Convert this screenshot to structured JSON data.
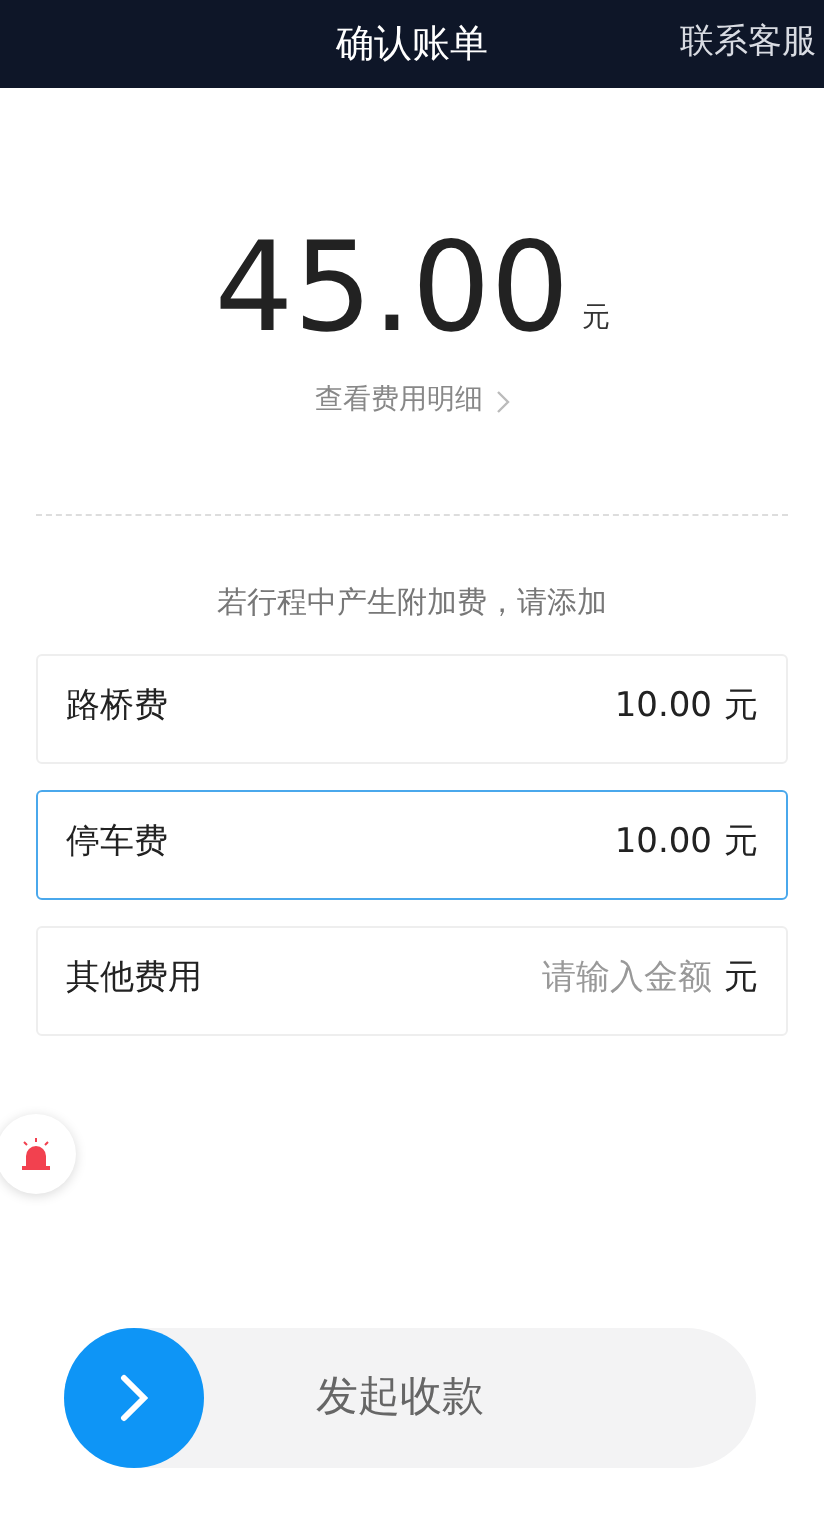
{
  "header": {
    "title": "确认账单",
    "action": "联系客服"
  },
  "total": {
    "amount": "45.00",
    "unit": "元",
    "detail_link": "查看费用明细"
  },
  "extra_note": "若行程中产生附加费，请添加",
  "fees": [
    {
      "label": "路桥费",
      "value": "10.00",
      "unit": "元",
      "selected": false
    },
    {
      "label": "停车费",
      "value": "10.00",
      "unit": "元",
      "selected": true
    },
    {
      "label": "其他费用",
      "placeholder": "请输入金额",
      "unit": "元",
      "selected": false
    }
  ],
  "slide_button": {
    "label": "发起收款"
  }
}
